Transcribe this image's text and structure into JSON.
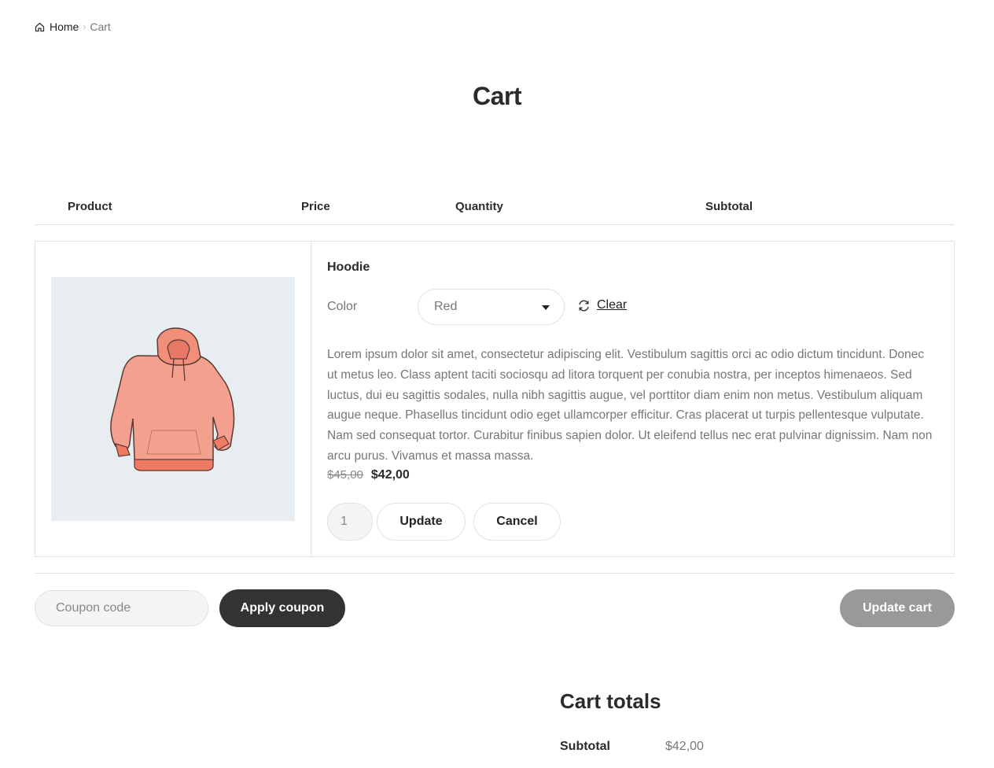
{
  "breadcrumb": {
    "home_label": "Home",
    "separator": "›",
    "current_label": "Cart"
  },
  "page": {
    "title": "Cart"
  },
  "cart_table": {
    "headers": {
      "product": "Product",
      "price": "Price",
      "quantity": "Quantity",
      "subtotal": "Subtotal"
    }
  },
  "cart_item": {
    "image_icon": "hoodie-illustration",
    "name": "Hoodie",
    "color_label": "Color",
    "color_selected": "Red",
    "clear_label": "Clear",
    "description": "Lorem ipsum dolor sit amet, consectetur adipiscing elit. Vestibulum sagittis orci ac odio dictum tincidunt. Donec ut metus leo. Class aptent taciti sociosqu ad litora torquent per conubia nostra, per inceptos himenaeos. Sed luctus, dui eu sagittis sodales, nulla nibh sagittis augue, vel porttitor diam enim non metus. Vestibulum aliquam augue neque. Phasellus tincidunt odio eget ullamcorper efficitur. Cras placerat ut turpis pellentesque vulputate. Nam sed consequat tortor. Curabitur finibus sapien dolor. Ut eleifend tellus nec erat pulvinar dignissim. Nam non arcu purus. Vivamus et massa massa.",
    "price_old": "$45,00",
    "price_new": "$42,00",
    "quantity": "1",
    "update_label": "Update",
    "cancel_label": "Cancel"
  },
  "actions": {
    "coupon_placeholder": "Coupon code",
    "apply_coupon_label": "Apply coupon",
    "update_cart_label": "Update cart"
  },
  "totals": {
    "title": "Cart totals",
    "subtotal_label": "Subtotal",
    "subtotal_value": "$42,00"
  },
  "colors": {
    "primary_button": "#333333",
    "disabled_button": "#999999",
    "image_bg": "#e8edf1",
    "hoodie": "#f4a08e"
  }
}
